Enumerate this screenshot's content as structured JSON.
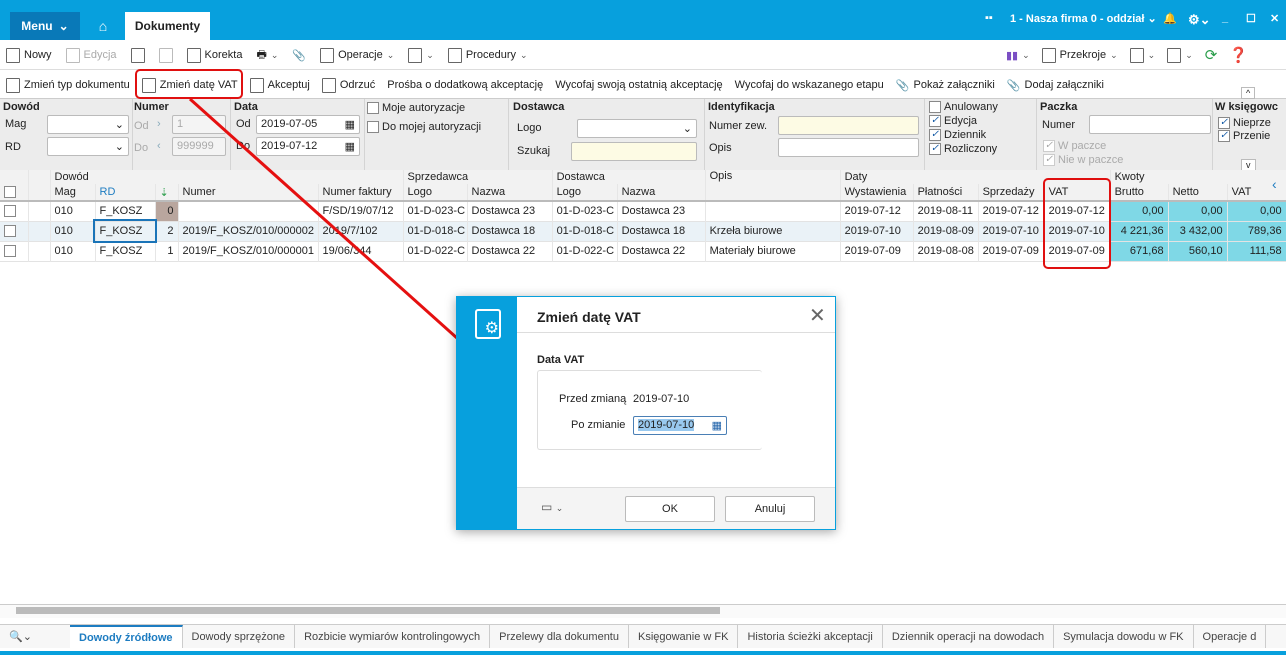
{
  "titlebar": {
    "menu": "Menu",
    "tab": "Dokumenty",
    "company": "1 - Nasza firma 0 - oddział"
  },
  "toolbar1": {
    "nowy": "Nowy",
    "edycja": "Edycja",
    "korekta": "Korekta",
    "operacje": "Operacje",
    "procedury": "Procedury",
    "przekroje": "Przekroje"
  },
  "toolbar2": {
    "items": [
      "Zmień typ dokumentu",
      "Zmień datę VAT",
      "Akceptuj",
      "Odrzuć",
      "Prośba o dodatkową akceptację",
      "Wycofaj swoją ostatnią akceptację",
      "Wycofaj do wskazanego etapu",
      "Pokaż załączniki",
      "Dodaj załączniki"
    ]
  },
  "filters": {
    "dowod": "Dowód",
    "mag": "Mag",
    "rd": "RD",
    "numer": "Numer",
    "od": "Od",
    "do": "Do",
    "num_od": "1",
    "num_do": "999999",
    "data": "Data",
    "data_od": "2019-07-05",
    "data_do": "2019-07-12",
    "moje": "Moje autoryzacje",
    "do_mojej": "Do mojej autoryzacji",
    "dostawca": "Dostawca",
    "logo": "Logo",
    "szukaj": "Szukaj",
    "identyfikacja": "Identyfikacja",
    "numer_zew": "Numer zew.",
    "opis": "Opis",
    "anulowany": "Anulowany",
    "edycja": "Edycja",
    "dziennik": "Dziennik",
    "rozliczony": "Rozliczony",
    "paczka": "Paczka",
    "paczka_numer": "Numer",
    "w_paczce": "W paczce",
    "nie_w_paczce": "Nie w paczce",
    "w_ksiegowosci": "W księgowc",
    "nieprze": "Nieprze",
    "przenie": "Przenie"
  },
  "grid": {
    "groups": {
      "dowod": "Dowód",
      "sprzedawca": "Sprzedawca",
      "dostawca": "Dostawca",
      "opis": "Opis",
      "daty": "Daty",
      "kwoty": "Kwoty"
    },
    "columns": [
      "Mag",
      "RD",
      "",
      "Numer",
      "Numer faktury",
      "Logo",
      "Nazwa",
      "Logo",
      "Nazwa",
      "",
      "Wystawienia",
      "Płatności",
      "Sprzedaży",
      "VAT",
      "Brutto",
      "Netto",
      "VAT"
    ],
    "rows": [
      [
        "010",
        "F_KOSZ",
        "0",
        "",
        "F/SD/19/07/12",
        "01-D-023-C",
        "Dostawca 23",
        "01-D-023-C",
        "Dostawca 23",
        "",
        "2019-07-12",
        "2019-08-11",
        "2019-07-12",
        "2019-07-12",
        "0,00",
        "0,00",
        "0,00"
      ],
      [
        "010",
        "F_KOSZ",
        "2",
        "2019/F_KOSZ/010/000002",
        "2019/7/102",
        "01-D-018-C",
        "Dostawca 18",
        "01-D-018-C",
        "Dostawca 18",
        "Krzeła biurowe",
        "2019-07-10",
        "2019-08-09",
        "2019-07-10",
        "2019-07-10",
        "4 221,36",
        "3 432,00",
        "789,36"
      ],
      [
        "010",
        "F_KOSZ",
        "1",
        "2019/F_KOSZ/010/000001",
        "19/06/344",
        "01-D-022-C",
        "Dostawca 22",
        "01-D-022-C",
        "Dostawca 22",
        "Materiały biurowe",
        "2019-07-09",
        "2019-08-08",
        "2019-07-09",
        "2019-07-09",
        "671,68",
        "560,10",
        "111,58"
      ]
    ]
  },
  "bottom_tabs": [
    "Dowody źródłowe",
    "Dowody sprzężone",
    "Rozbicie wymiarów kontrolingowych",
    "Przelewy dla dokumentu",
    "Księgowanie w FK",
    "Historia ścieżki akceptacji",
    "Dziennik operacji na dowodach",
    "Symulacja dowodu w FK",
    "Operacje d"
  ],
  "dialog": {
    "title": "Zmień datę VAT",
    "section": "Data VAT",
    "przed_label": "Przed zmianą",
    "przed_value": "2019-07-10",
    "po_label": "Po zmianie",
    "po_value": "2019-07-10",
    "ok": "OK",
    "anuluj": "Anuluj"
  }
}
